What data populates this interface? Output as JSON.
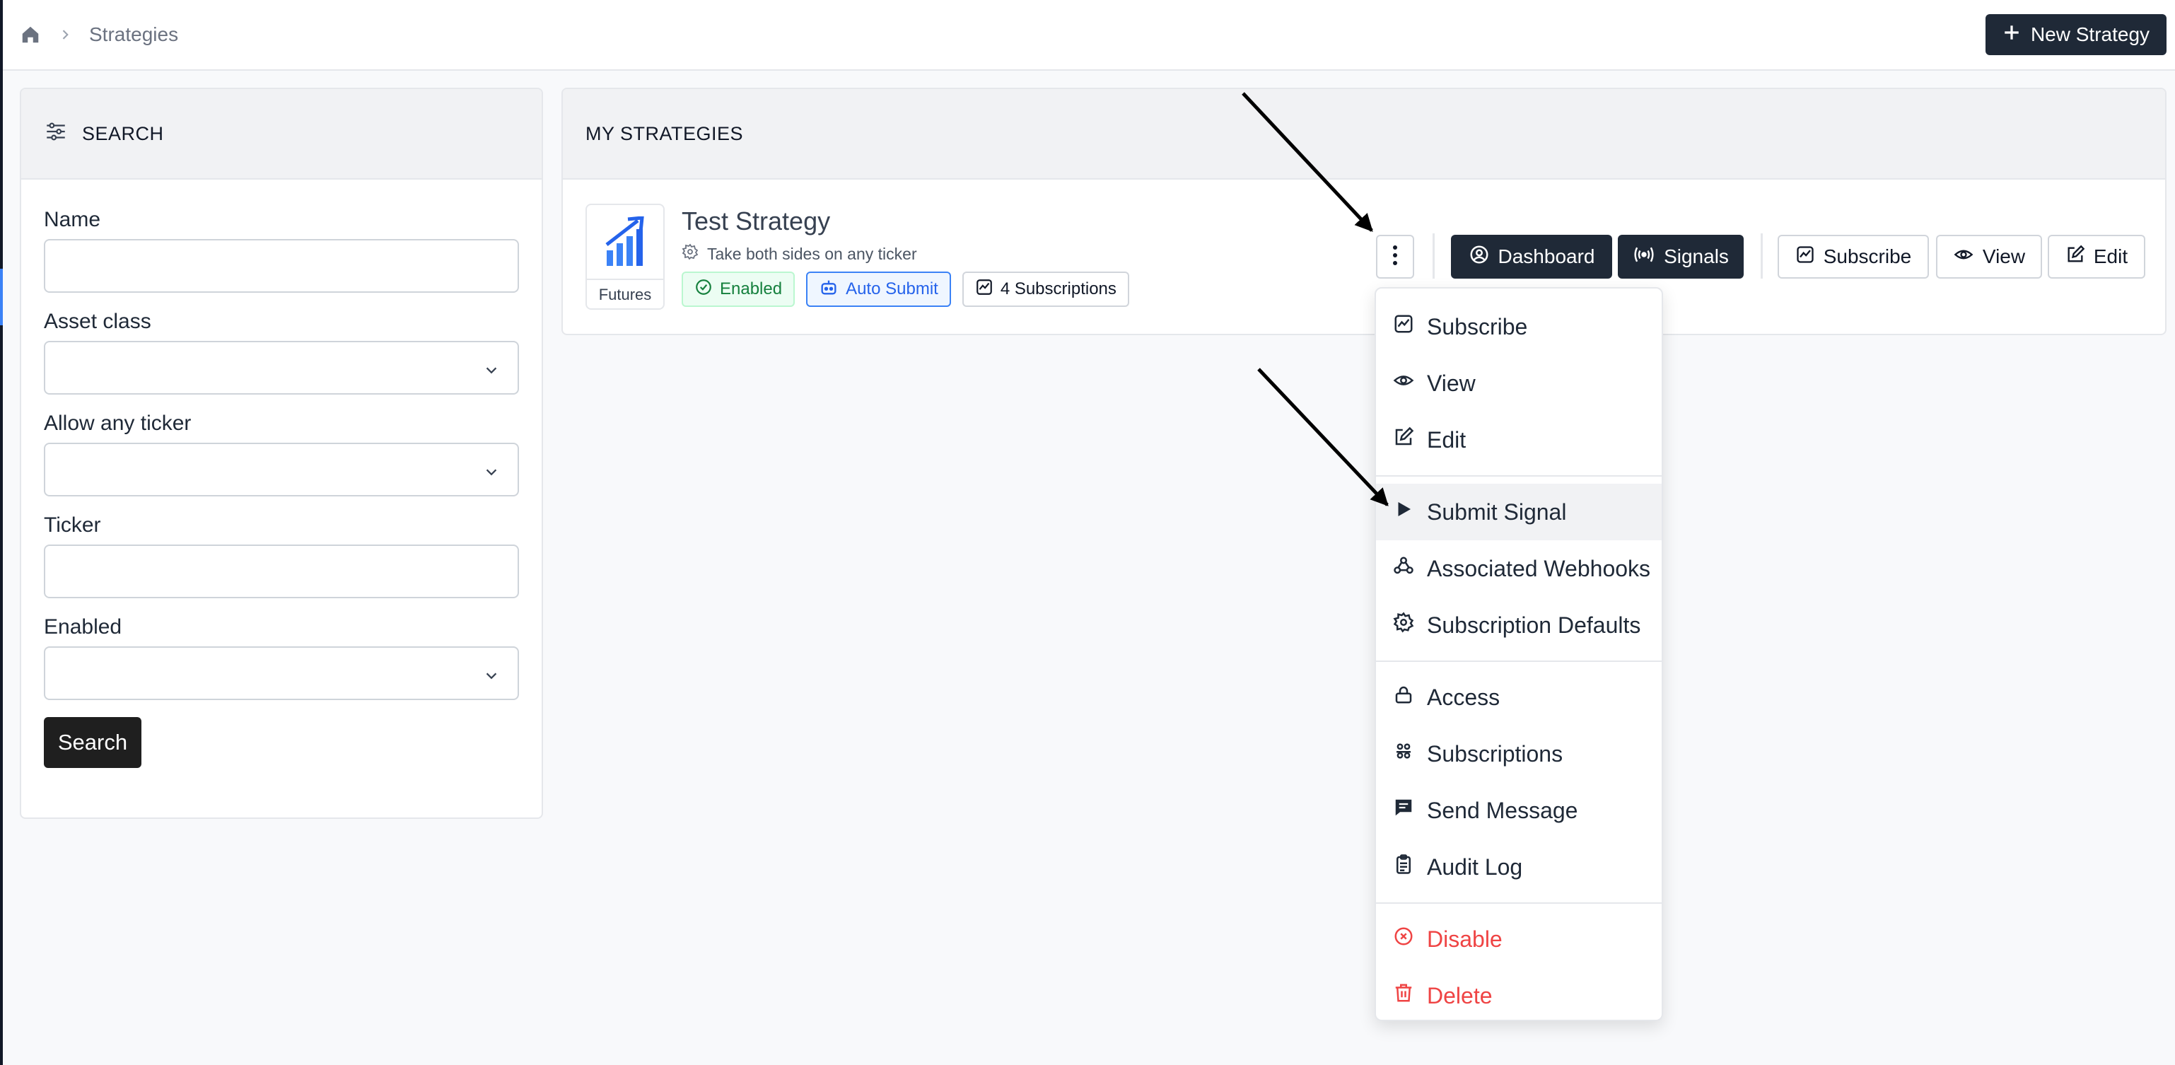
{
  "breadcrumb": {
    "current": "Strategies"
  },
  "header": {
    "new_strategy_label": "New Strategy"
  },
  "search_panel": {
    "title": "SEARCH",
    "fields": {
      "name": {
        "label": "Name",
        "value": ""
      },
      "asset_class": {
        "label": "Asset class",
        "value": ""
      },
      "allow_any_ticker": {
        "label": "Allow any ticker",
        "value": ""
      },
      "ticker": {
        "label": "Ticker",
        "value": ""
      },
      "enabled": {
        "label": "Enabled",
        "value": ""
      }
    },
    "search_button": "Search"
  },
  "strategies_panel": {
    "title": "MY STRATEGIES",
    "strategy": {
      "name": "Test Strategy",
      "description": "Take both sides on any ticker",
      "asset_tag": "Futures",
      "badges": {
        "enabled": "Enabled",
        "auto_submit": "Auto Submit",
        "subscriptions": "4 Subscriptions"
      },
      "actions": {
        "dashboard": "Dashboard",
        "signals": "Signals",
        "subscribe": "Subscribe",
        "view": "View",
        "edit": "Edit"
      }
    }
  },
  "dropdown_menu": {
    "items": [
      {
        "label": "Subscribe",
        "icon": "chart-icon"
      },
      {
        "label": "View",
        "icon": "eye-icon"
      },
      {
        "label": "Edit",
        "icon": "edit-icon"
      },
      {
        "label": "Submit Signal",
        "icon": "play-icon",
        "highlighted": true
      },
      {
        "label": "Associated Webhooks",
        "icon": "webhook-icon"
      },
      {
        "label": "Subscription Defaults",
        "icon": "gear-icon"
      },
      {
        "label": "Access",
        "icon": "lock-icon"
      },
      {
        "label": "Subscriptions",
        "icon": "users-icon"
      },
      {
        "label": "Send Message",
        "icon": "message-icon"
      },
      {
        "label": "Audit Log",
        "icon": "clipboard-icon"
      },
      {
        "label": "Disable",
        "icon": "x-circle-icon",
        "danger": true
      },
      {
        "label": "Delete",
        "icon": "trash-icon",
        "danger": true
      }
    ]
  },
  "colors": {
    "primary_dark": "#1f2937",
    "enabled_green": "#15803d",
    "auto_submit_blue": "#2563eb",
    "danger_red": "#ef4444"
  }
}
